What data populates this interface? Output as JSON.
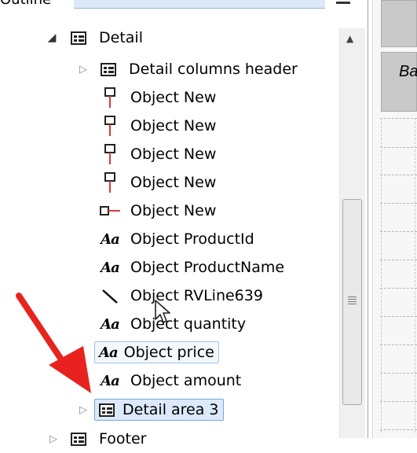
{
  "panel": {
    "title": "Outline"
  },
  "tree": {
    "nodes": [
      {
        "label": "Detail",
        "icon": "grid-icon",
        "expander": "expanded"
      },
      {
        "label": "Detail columns header",
        "icon": "grid-icon",
        "expander": "collapsed"
      },
      {
        "label": "Object New",
        "icon": "pin-icon"
      },
      {
        "label": "Object New",
        "icon": "pin-icon"
      },
      {
        "label": "Object New",
        "icon": "pin-icon"
      },
      {
        "label": "Object New",
        "icon": "pin-icon"
      },
      {
        "label": "Object New",
        "icon": "horizontal-pin-icon"
      },
      {
        "label": "Object ProductId",
        "icon": "text-field-icon",
        "icon_text": "Aa"
      },
      {
        "label": "Object ProductName",
        "icon": "text-field-icon",
        "icon_text": "Aa"
      },
      {
        "label": "Object RVLine639",
        "icon": "line-icon"
      },
      {
        "label": "Object quantity",
        "icon": "text-field-icon",
        "icon_text": "Aa"
      },
      {
        "label": "Object price",
        "icon": "text-field-icon",
        "icon_text": "Aa",
        "state": "hover"
      },
      {
        "label": "Object amount",
        "icon": "text-field-icon",
        "icon_text": "Aa"
      },
      {
        "label": "Detail area 3",
        "icon": "grid-icon",
        "expander": "collapsed",
        "state": "selected"
      },
      {
        "label": "Footer",
        "icon": "grid-icon",
        "expander": "collapsed"
      }
    ]
  },
  "right_panel": {
    "cell_text": "Ba"
  },
  "colors": {
    "selection": "#dbe9fb",
    "hover": "#f3f8fe",
    "pin_red": "#d43c3c",
    "annotation_arrow": "#e8231f"
  }
}
